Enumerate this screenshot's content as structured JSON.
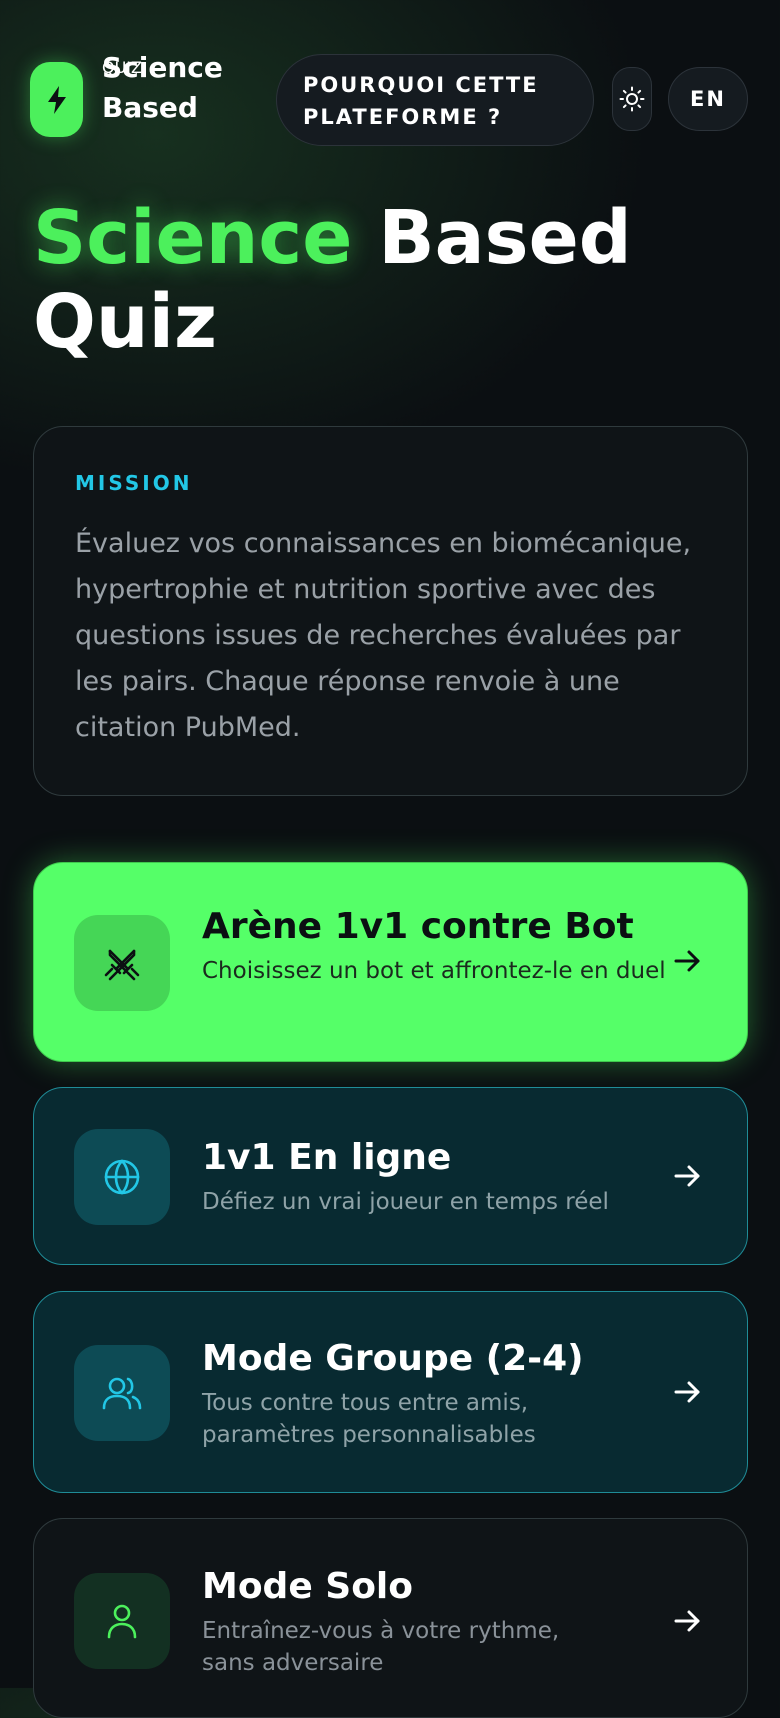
{
  "header": {
    "brand_line1": "Science",
    "brand_line2": "Based",
    "brand_sub": "QUIZ",
    "why_line1": "POURQUOI CETTE",
    "why_line2": "PLATEFORME ?",
    "lang": "EN"
  },
  "hero": {
    "title_green": "Science",
    "title_rest1": "Based",
    "title_rest2": "Quiz"
  },
  "mission": {
    "label": "MISSION",
    "text": "Évaluez vos connaissances en biomécanique, hypertrophie et nutrition sportive avec des questions issues de recherches évaluées par les pairs. Chaque réponse renvoie à une citation PubMed."
  },
  "modes": [
    {
      "title": "Arène 1v1 contre Bot",
      "desc": "Choisissez un bot et affrontez-le en duel",
      "icon": "swords-icon"
    },
    {
      "title": "1v1 En ligne",
      "desc": "Défiez un vrai joueur en temps réel",
      "icon": "globe-icon"
    },
    {
      "title": "Mode Groupe (2-4)",
      "desc": "Tous contre tous entre amis, paramètres personnalisables",
      "icon": "users-icon"
    },
    {
      "title": "Mode Solo",
      "desc": "Entraînez-vous à votre rythme, sans adversaire",
      "icon": "user-icon"
    }
  ],
  "colors": {
    "accent_green": "#4cf05c",
    "accent_cyan": "#22c7e6",
    "background": "#0b0f12"
  }
}
